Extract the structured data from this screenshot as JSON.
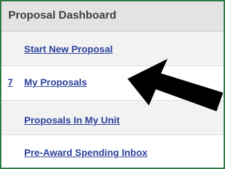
{
  "header": {
    "title": "Proposal Dashboard"
  },
  "rows": [
    {
      "label": "Start New Proposal",
      "count": ""
    },
    {
      "label": "My Proposals",
      "count": "7"
    },
    {
      "label": "Proposals In My Unit",
      "count": ""
    },
    {
      "label": "Pre-Award Spending Inbox",
      "count": ""
    }
  ],
  "colors": {
    "frame_border": "#2c7a3b",
    "link": "#2a3f9a",
    "header_bg": "#e3e3e3",
    "arrow": "#000000"
  },
  "icons": {
    "annotation": "arrow-pointer-icon"
  }
}
